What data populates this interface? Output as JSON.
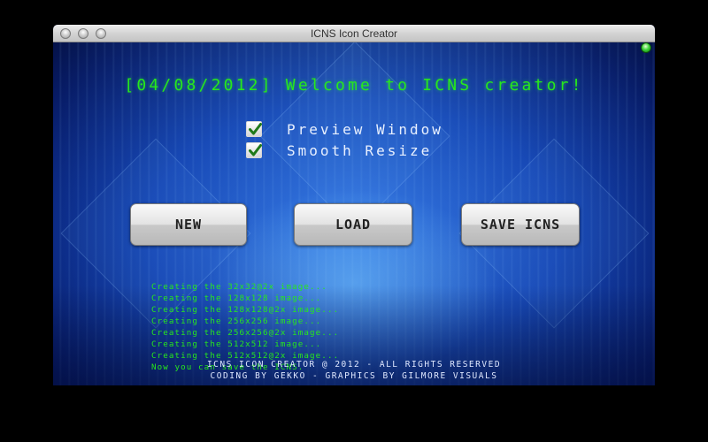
{
  "window": {
    "title": "ICNS Icon Creator"
  },
  "header": {
    "welcome": "[04/08/2012] Welcome to ICNS creator!"
  },
  "options": [
    {
      "label": "Preview Window",
      "checked": true
    },
    {
      "label": "Smooth Resize",
      "checked": true
    }
  ],
  "buttons": {
    "new_label": "NEW",
    "load_label": "LOAD",
    "save_label": "SAVE ICNS"
  },
  "log": [
    "Creating the 32x32@2x image...",
    "Creating the 128x128 image...",
    "Creating the 128x128@2x image...",
    "Creating the 256x256 image...",
    "Creating the 256x256@2x image...",
    "Creating the 512x512 image...",
    "Creating the 512x512@2x image...",
    "Now you can save the ICNS."
  ],
  "footer": {
    "line1": "ICNS ICON CREATOR @ 2012 - ALL RIGHTS RESERVED",
    "line2": "CODING BY GEKKO - GRAPHICS BY GILMORE VISUALS"
  },
  "colors": {
    "console_green": "#27e81c",
    "background_blue": "#1240b0"
  }
}
